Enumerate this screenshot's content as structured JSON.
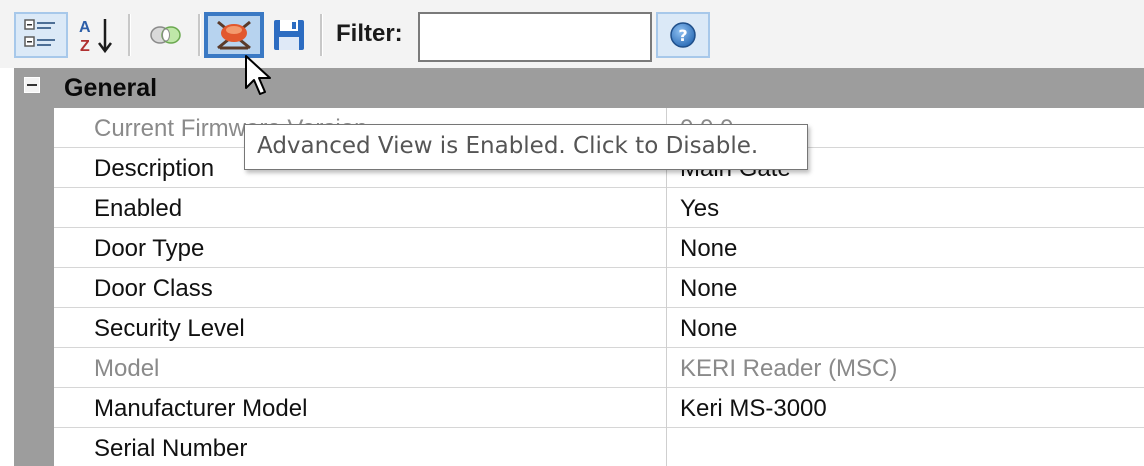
{
  "toolbar": {
    "buttons": {
      "categorized": {
        "icon": "categorized-view-icon"
      },
      "alphabetical": {
        "icon": "sort-alphabetical-icon"
      },
      "toggle": {
        "icon": "toggle-view-icon"
      },
      "advanced": {
        "icon": "advanced-view-icon",
        "state": "active"
      },
      "save": {
        "icon": "save-icon"
      },
      "help": {
        "icon": "help-icon"
      }
    },
    "filter_label": "Filter:",
    "filter_value": "",
    "filter_placeholder": ""
  },
  "grid": {
    "category": "General",
    "rows": [
      {
        "name": "Current Firmware Version",
        "value": "0.0.0",
        "readonly": true
      },
      {
        "name": "Description",
        "value": "Main Gate",
        "readonly": false
      },
      {
        "name": "Enabled",
        "value": "Yes",
        "readonly": false
      },
      {
        "name": "Door Type",
        "value": "None",
        "readonly": false
      },
      {
        "name": "Door Class",
        "value": "None",
        "readonly": false
      },
      {
        "name": "Security Level",
        "value": "None",
        "readonly": false
      },
      {
        "name": "Model",
        "value": "KERI Reader (MSC)",
        "readonly": true
      },
      {
        "name": "Manufacturer Model",
        "value": "Keri MS-3000",
        "readonly": false
      },
      {
        "name": "Serial Number",
        "value": "",
        "readonly": false
      }
    ]
  },
  "tooltip": {
    "text": "Advanced View is Enabled. Click to Disable."
  },
  "colors": {
    "category_background": "#9d9d9d",
    "active_button_border": "#3a79c4",
    "readonly_text": "#8a8a8a"
  }
}
